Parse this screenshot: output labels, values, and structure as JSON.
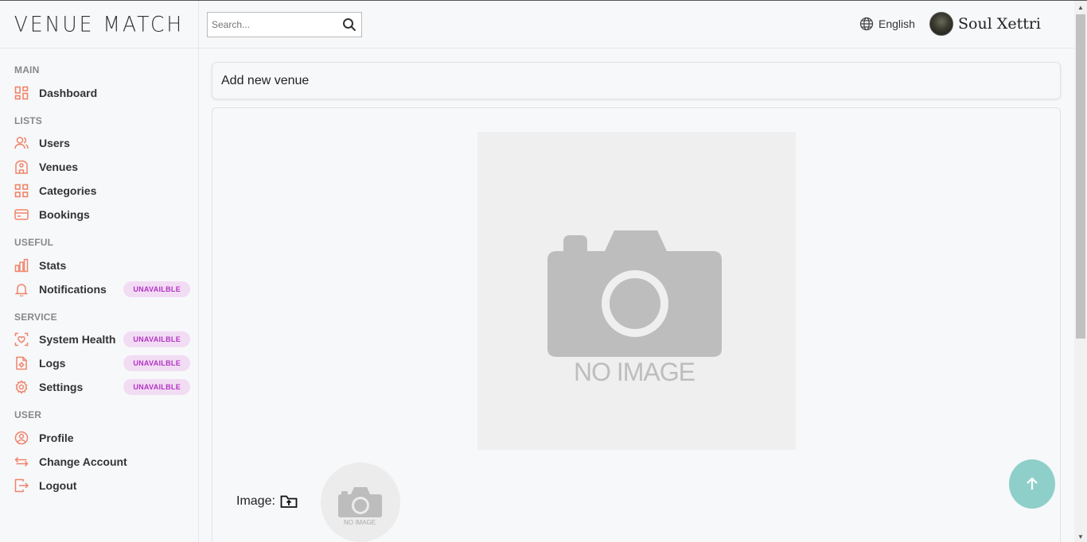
{
  "brand": {
    "logo_text": "VENUE MATCH"
  },
  "sidebar": {
    "sections": [
      {
        "title": "MAIN"
      },
      {
        "title": "LISTS"
      },
      {
        "title": "USEFUL"
      },
      {
        "title": "SERVICE"
      },
      {
        "title": "USER"
      }
    ],
    "items": [
      {
        "label": "Dashboard",
        "icon": "dashboard-icon"
      },
      {
        "label": "Users",
        "icon": "users-icon"
      },
      {
        "label": "Venues",
        "icon": "venue-icon"
      },
      {
        "label": "Categories",
        "icon": "categories-icon"
      },
      {
        "label": "Bookings",
        "icon": "bookings-icon"
      },
      {
        "label": "Stats",
        "icon": "stats-icon"
      },
      {
        "label": "Notifications",
        "icon": "bell-icon",
        "badge": "UNAVAILBLE"
      },
      {
        "label": "System Health",
        "icon": "health-icon",
        "badge": "UNAVAILBLE"
      },
      {
        "label": "Logs",
        "icon": "logs-icon",
        "badge": "UNAVAILBLE"
      },
      {
        "label": "Settings",
        "icon": "gear-icon",
        "badge": "UNAVAILBLE"
      },
      {
        "label": "Profile",
        "icon": "profile-icon"
      },
      {
        "label": "Change Account",
        "icon": "swap-icon"
      },
      {
        "label": "Logout",
        "icon": "logout-icon"
      }
    ],
    "icon_color": "#f0846a",
    "badge_bg": "#f2dcf4",
    "badge_color": "#b233c4"
  },
  "topbar": {
    "search_placeholder": "Search...",
    "language": "English",
    "user_name": "Soul Xettri"
  },
  "main": {
    "header_title": "Add new venue",
    "preview_text": "NO IMAGE",
    "image_label": "Image:",
    "thumb_text": "NO IMAGE"
  },
  "colors": {
    "accent_fab": "#8fcfca",
    "placeholder_gray": "#bdbdbd"
  }
}
